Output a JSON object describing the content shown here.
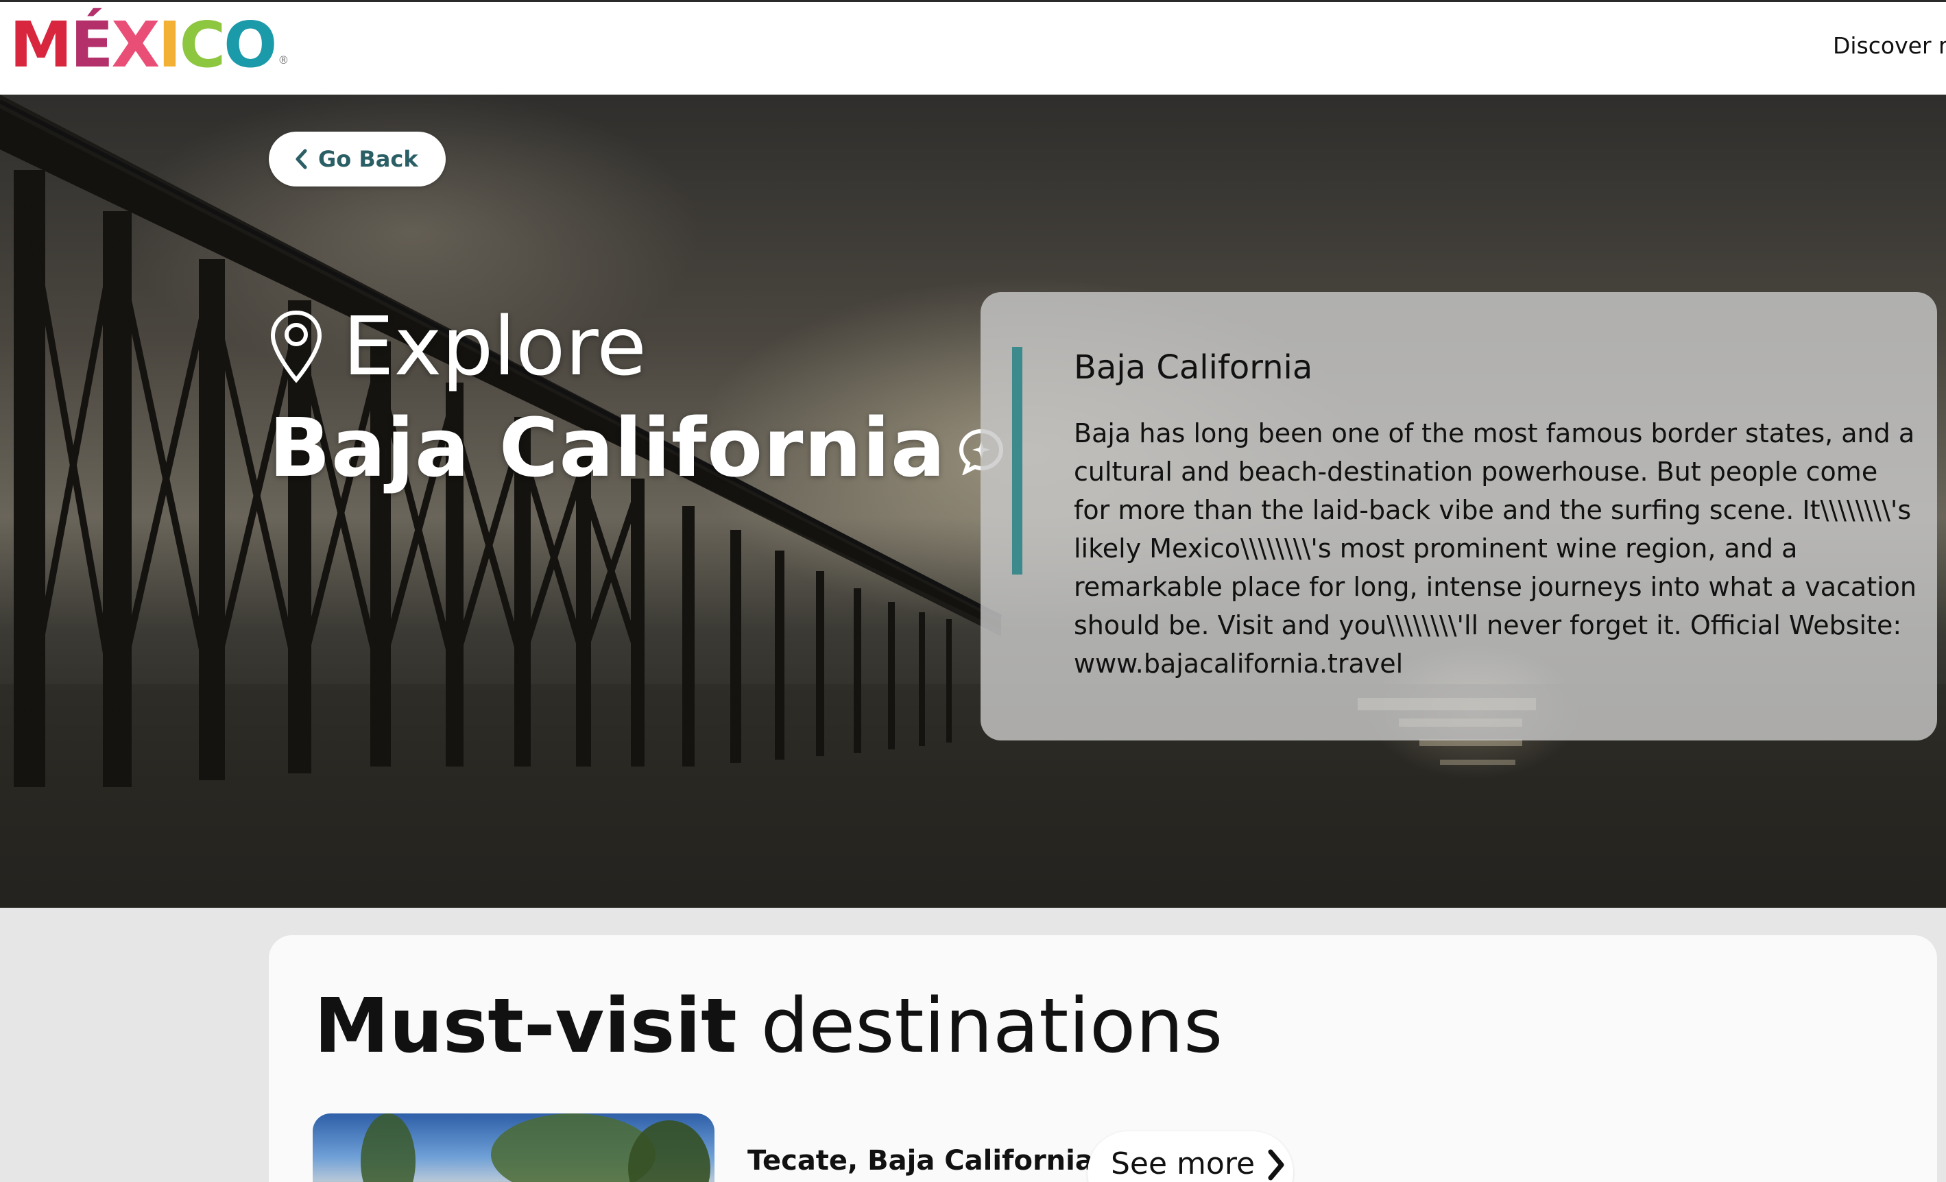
{
  "header": {
    "logo_letters": [
      "M",
      "É",
      "X",
      "I",
      "C",
      "O"
    ],
    "logo_colors": [
      "#d7263d",
      "#b3306b",
      "#e94e77",
      "#f2b134",
      "#8dc63f",
      "#1b9aaa"
    ],
    "logo_reg": "®",
    "nav_discover": "Discover r"
  },
  "hero": {
    "go_back_label": "Go Back",
    "explore_label": "Explore",
    "state_name": "Baja California",
    "icons": [
      "chevron-left-icon",
      "map-pin-icon",
      "chat-sparkle-icon"
    ]
  },
  "info_card": {
    "title": "Baja California",
    "body": "Baja has long been one of the most famous border states, and a cultural and beach-destination powerhouse. But people come for more than the laid-back vibe and the surfing scene. It\\\\\\\\\\\\\\\\'s likely Mexico\\\\\\\\\\\\\\\\'s most prominent wine region, and a remarkable place for long, intense journeys into what a vacation should be. Visit and you\\\\\\\\\\\\\\\\'ll never forget it. Official Website: www.bajacalifornia.travel",
    "accent_color": "#3d8a8c"
  },
  "destinations": {
    "heading_bold": "Must-visit",
    "heading_light": "destinations",
    "items": [
      {
        "name": "Tecate, Baja California",
        "see_more_label": "See more"
      }
    ]
  }
}
